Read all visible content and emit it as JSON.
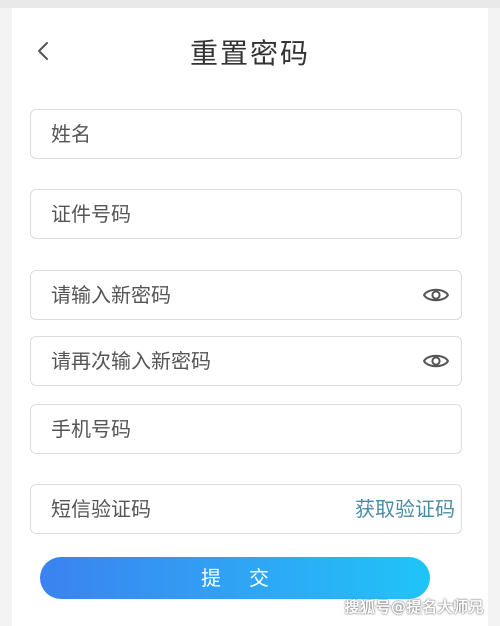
{
  "header": {
    "title": "重置密码",
    "back_icon": "chevron-left-icon"
  },
  "form": {
    "name_placeholder": "姓名",
    "id_number_placeholder": "证件号码",
    "new_password_placeholder": "请输入新密码",
    "confirm_password_placeholder": "请再次输入新密码",
    "phone_placeholder": "手机号码",
    "sms_code_placeholder": "短信验证码",
    "get_code_label": "获取验证码",
    "password_toggle_icon": "eye-icon"
  },
  "submit": {
    "label": "提交"
  },
  "watermark": {
    "text": "搜狐号@提名大师兄"
  },
  "colors": {
    "link": "#4a8ba6",
    "button_gradient_start": "#3b82f0",
    "button_gradient_end": "#1fc4f8"
  }
}
